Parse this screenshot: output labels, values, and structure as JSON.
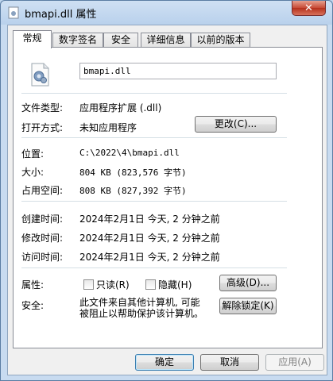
{
  "window": {
    "title": "bmapi.dll 属性",
    "close_glyph": "✕"
  },
  "tabs": [
    {
      "label": "常规"
    },
    {
      "label": "数字签名"
    },
    {
      "label": "安全"
    },
    {
      "label": "详细信息"
    },
    {
      "label": "以前的版本"
    }
  ],
  "general": {
    "file_name": "bmapi.dll",
    "file_type_label": "文件类型:",
    "file_type_value": "应用程序扩展 (.dll)",
    "opens_with_label": "打开方式:",
    "opens_with_value": "未知应用程序",
    "change_button": "更改(C)...",
    "location_label": "位置:",
    "location_value": "C:\\2022\\4\\bmapi.dll",
    "size_label": "大小:",
    "size_value": "804 KB (823,576 字节)",
    "disk_size_label": "占用空间:",
    "disk_size_value": "808 KB (827,392 字节)",
    "created_label": "创建时间:",
    "created_value": "2024年2月1日 今天, 2 分钟之前",
    "modified_label": "修改时间:",
    "modified_value": "2024年2月1日 今天, 2 分钟之前",
    "accessed_label": "访问时间:",
    "accessed_value": "2024年2月1日 今天, 2 分钟之前",
    "attributes_label": "属性:",
    "readonly_label": "只读(R)",
    "hidden_label": "隐藏(H)",
    "advanced_button": "高级(D)...",
    "security_label": "安全:",
    "security_text_line1": "此文件来自其他计算机, 可能",
    "security_text_line2": "被阻止以帮助保护该计算机。",
    "unblock_button": "解除锁定(K)"
  },
  "footer": {
    "ok": "确定",
    "cancel": "取消",
    "apply": "应用(A)"
  }
}
